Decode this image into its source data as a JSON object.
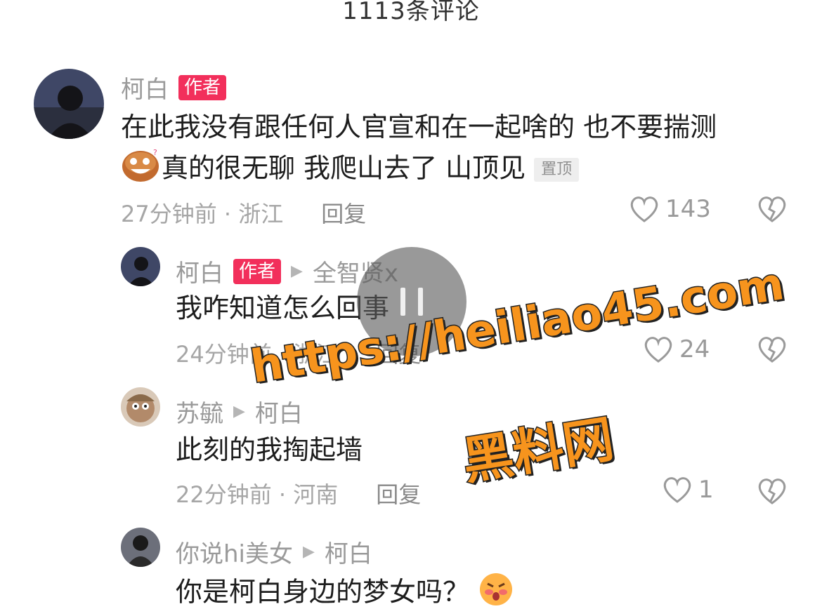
{
  "header": {
    "title": "1113条评论"
  },
  "colors": {
    "author_badge": "#f22f5b",
    "watermark": "#f7941d",
    "muted": "#9a9a9a"
  },
  "comments": [
    {
      "name": "柯白",
      "badge": "作者",
      "line1": "在此我没有跟任何人官宣和在一起啥的 也不要揣测",
      "line2": "真的很无聊 我爬山去了 山顶见",
      "pinned": "置顶",
      "time": "27分钟前 · 浙江",
      "reply": "回复",
      "likes": "143",
      "icons": [
        "avatar",
        "laughing-emoji-icon",
        "heart-icon",
        "broken-heart-icon"
      ]
    },
    {
      "name": "柯白",
      "badge": "作者",
      "reply_to": "全智贤x",
      "text": "我咋知道怎么回事",
      "time": "24分钟前 · 浙江",
      "reply": "回复",
      "likes": "24"
    },
    {
      "name": "苏毓",
      "reply_to": "柯白",
      "text": "此刻的我掏起墙",
      "time": "22分钟前 · 河南",
      "reply": "回复",
      "likes": "1"
    },
    {
      "name": "你说hi美女",
      "reply_to": "柯白",
      "text": "你是柯白身边的梦女吗？"
    }
  ],
  "overlay": {
    "icon": "pause-icon"
  },
  "watermark": {
    "url": "https://heiliao45.com",
    "site": "黑料网"
  }
}
